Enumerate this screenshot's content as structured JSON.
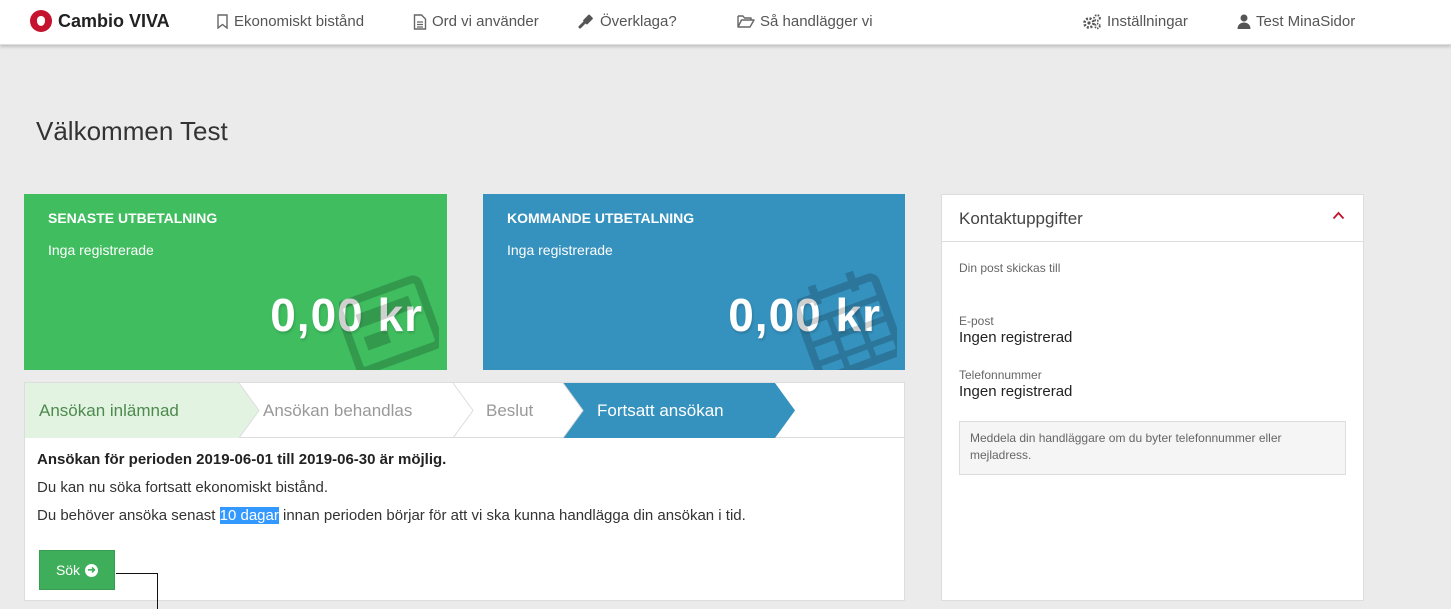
{
  "nav": {
    "brand": "Cambio VIVA",
    "items": [
      {
        "label": "Ekonomiskt bistånd",
        "icon": "bookmark-icon"
      },
      {
        "label": "Ord vi använder",
        "icon": "document-icon"
      },
      {
        "label": "Överklaga?",
        "icon": "gavel-icon"
      },
      {
        "label": "Så handlägger vi",
        "icon": "folder-open-icon"
      }
    ],
    "settings": {
      "label": "Inställningar",
      "icon": "gears-icon"
    },
    "user": {
      "label": "Test MinaSidor",
      "icon": "user-icon"
    }
  },
  "page": {
    "title": "Välkommen Test"
  },
  "latest_payment": {
    "title": "SENASTE UTBETALNING",
    "subtitle": "Inga registrerade",
    "amount": "0,00 kr",
    "color": "#3fbd5f"
  },
  "upcoming_payment": {
    "title": "KOMMANDE UTBETALNING",
    "subtitle": "Inga registrerade",
    "amount": "0,00 kr",
    "color": "#3591bd"
  },
  "application": {
    "steps": [
      {
        "label": "Ansökan inlämnad",
        "state": "done"
      },
      {
        "label": "Ansökan behandlas",
        "state": "pending"
      },
      {
        "label": "Beslut",
        "state": "pending"
      },
      {
        "label": "Fortsatt ansökan",
        "state": "active"
      }
    ],
    "heading": "Ansökan för perioden 2019-06-01 till 2019-06-30 är möjlig.",
    "text1": "Du kan nu söka fortsatt ekonomiskt bistånd.",
    "text2_before": "Du behöver ansöka senast ",
    "text2_highlight": "10 dagar",
    "text2_after": " innan perioden börjar för att vi ska kunna handlägga din ansökan i tid.",
    "button_label": "Sök"
  },
  "contact": {
    "title": "Kontaktuppgifter",
    "mail_label": "Din post skickas till",
    "email_label": "E-post",
    "email_value": "Ingen registrerad",
    "phone_label": "Telefonnummer",
    "phone_value": "Ingen registrerad",
    "notice": "Meddela din handläggare om du byter telefonnummer eller mejladress."
  }
}
